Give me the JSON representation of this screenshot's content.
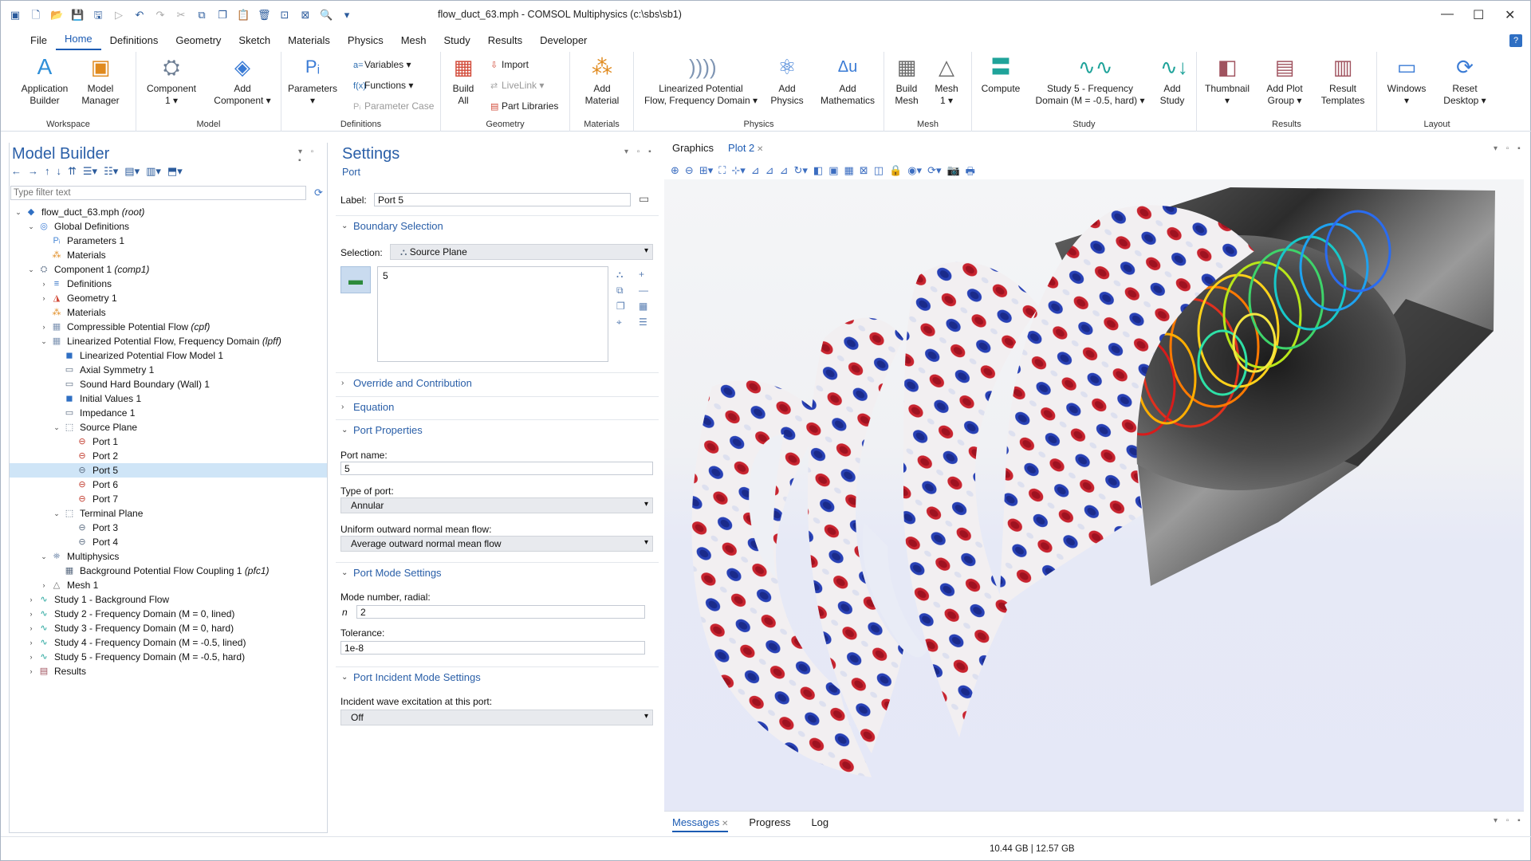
{
  "window": {
    "title": "flow_duct_63.mph - COMSOL Multiphysics (c:\\sbs\\sb1)",
    "minimize_glyph": "—",
    "maximize_glyph": "☐",
    "close_glyph": "✕"
  },
  "menu": {
    "tabs": [
      "File",
      "Home",
      "Definitions",
      "Geometry",
      "Sketch",
      "Materials",
      "Physics",
      "Mesh",
      "Study",
      "Results",
      "Developer"
    ],
    "active": "Home",
    "help": "?"
  },
  "ribbon": {
    "groups": {
      "workspace": "Workspace",
      "model": "Model",
      "definitions": "Definitions",
      "geometry": "Geometry",
      "materials": "Materials",
      "physics": "Physics",
      "mesh": "Mesh",
      "study": "Study",
      "results": "Results",
      "layout": "Layout"
    },
    "buttons": {
      "app_builder": [
        "Application",
        "Builder"
      ],
      "model_manager": [
        "Model",
        "Manager"
      ],
      "component": [
        "Component",
        "1 ▾"
      ],
      "add_component": [
        "Add",
        "Component ▾"
      ],
      "parameters": [
        "Parameters",
        "▾"
      ],
      "variables": "Variables ▾",
      "functions": "Functions ▾",
      "parameter_case": "Parameter Case",
      "build_all": [
        "Build",
        "All"
      ],
      "import": "Import",
      "livelink": "LiveLink ▾",
      "part_libraries": "Part Libraries",
      "add_material": [
        "Add",
        "Material"
      ],
      "lpff": [
        "Linearized Potential",
        "Flow, Frequency Domain ▾"
      ],
      "add_physics": [
        "Add",
        "Physics"
      ],
      "add_mathematics": [
        "Add",
        "Mathematics"
      ],
      "build_mesh": [
        "Build",
        "Mesh"
      ],
      "mesh1": [
        "Mesh",
        "1 ▾"
      ],
      "compute": [
        "Compute",
        ""
      ],
      "study5": [
        "Study 5 - Frequency",
        "Domain (M = -0.5, hard) ▾"
      ],
      "add_study": [
        "Add",
        "Study"
      ],
      "thumbnail": [
        "Thumbnail",
        "▾"
      ],
      "add_plot_group": [
        "Add Plot",
        "Group ▾"
      ],
      "result_templates": [
        "Result",
        "Templates"
      ],
      "windows": [
        "Windows",
        "▾"
      ],
      "reset_desktop": [
        "Reset",
        "Desktop ▾"
      ]
    }
  },
  "model_builder": {
    "title": "Model Builder",
    "filter_placeholder": "Type filter text",
    "tree": [
      {
        "label": "flow_duct_63.mph",
        "italic": "(root)",
        "level": 0,
        "exp": "v",
        "icon": "model-icon",
        "color": "#2f6fc3"
      },
      {
        "label": "Global Definitions",
        "italic": "",
        "level": 1,
        "exp": "v",
        "icon": "globe-icon",
        "color": "#3a7bd5"
      },
      {
        "label": "Parameters 1",
        "italic": "",
        "level": 2,
        "exp": "",
        "icon": "parameters-icon",
        "color": "#4a88d6"
      },
      {
        "label": "Materials",
        "italic": "",
        "level": 2,
        "exp": "",
        "icon": "materials-icon",
        "color": "#e08a1e"
      },
      {
        "label": "Component 1",
        "italic": "(comp1)",
        "level": 1,
        "exp": "v",
        "icon": "component-icon",
        "color": "#6d7e94"
      },
      {
        "label": "Definitions",
        "italic": "",
        "level": 2,
        "exp": ">",
        "icon": "definitions-icon",
        "color": "#2f6fc3"
      },
      {
        "label": "Geometry 1",
        "italic": "",
        "level": 2,
        "exp": ">",
        "icon": "geometry-icon",
        "color": "#d24b3a"
      },
      {
        "label": "Materials",
        "italic": "",
        "level": 2,
        "exp": "",
        "icon": "materials-icon",
        "color": "#e08a1e"
      },
      {
        "label": "Compressible Potential Flow",
        "italic": "(cpf)",
        "level": 2,
        "exp": ">",
        "icon": "flow-icon",
        "color": "#7f95b3"
      },
      {
        "label": "Linearized Potential Flow, Frequency Domain",
        "italic": "(lpff)",
        "level": 2,
        "exp": "v",
        "icon": "acoustics-icon",
        "color": "#7f95b3"
      },
      {
        "label": "Linearized Potential Flow Model 1",
        "italic": "",
        "level": 3,
        "exp": "",
        "icon": "domain-feature-icon",
        "color": "#2f6fc3"
      },
      {
        "label": "Axial Symmetry 1",
        "italic": "",
        "level": 3,
        "exp": "",
        "icon": "boundary-feature-icon",
        "color": "#5a6b80"
      },
      {
        "label": "Sound Hard Boundary (Wall) 1",
        "italic": "",
        "level": 3,
        "exp": "",
        "icon": "boundary-feature-icon",
        "color": "#5a6b80"
      },
      {
        "label": "Initial Values 1",
        "italic": "",
        "level": 3,
        "exp": "",
        "icon": "domain-feature-icon",
        "color": "#2f6fc3"
      },
      {
        "label": "Impedance 1",
        "italic": "",
        "level": 3,
        "exp": "",
        "icon": "boundary-feature-icon",
        "color": "#5a6b80"
      },
      {
        "label": "Source Plane",
        "italic": "",
        "level": 3,
        "exp": "v",
        "icon": "port-group-icon",
        "color": "#5a6b80"
      },
      {
        "label": "Port 1",
        "italic": "",
        "level": 4,
        "exp": "",
        "icon": "port-icon",
        "color": "#c0392b"
      },
      {
        "label": "Port 2",
        "italic": "",
        "level": 4,
        "exp": "",
        "icon": "port-icon",
        "color": "#c0392b"
      },
      {
        "label": "Port 5",
        "italic": "",
        "level": 4,
        "exp": "",
        "icon": "port-icon",
        "color": "#5a6b80",
        "selected": true
      },
      {
        "label": "Port 6",
        "italic": "",
        "level": 4,
        "exp": "",
        "icon": "port-icon",
        "color": "#c0392b"
      },
      {
        "label": "Port 7",
        "italic": "",
        "level": 4,
        "exp": "",
        "icon": "port-icon",
        "color": "#c0392b"
      },
      {
        "label": "Terminal Plane",
        "italic": "",
        "level": 3,
        "exp": "v",
        "icon": "port-group-icon",
        "color": "#5a6b80"
      },
      {
        "label": "Port 3",
        "italic": "",
        "level": 4,
        "exp": "",
        "icon": "port-icon",
        "color": "#5a6b80"
      },
      {
        "label": "Port 4",
        "italic": "",
        "level": 4,
        "exp": "",
        "icon": "port-icon",
        "color": "#5a6b80"
      },
      {
        "label": "Multiphysics",
        "italic": "",
        "level": 2,
        "exp": "v",
        "icon": "multiphysics-icon",
        "color": "#7f95b3"
      },
      {
        "label": "Background Potential Flow Coupling 1",
        "italic": "(pfc1)",
        "level": 3,
        "exp": "",
        "icon": "coupling-icon",
        "color": "#5a6b80"
      },
      {
        "label": "Mesh 1",
        "italic": "",
        "level": 2,
        "exp": ">",
        "icon": "mesh-icon",
        "color": "#6b6b6b"
      },
      {
        "label": "Study 1 - Background Flow",
        "italic": "",
        "level": 1,
        "exp": ">",
        "icon": "study-icon",
        "color": "#1fa39a"
      },
      {
        "label": "Study 2 - Frequency Domain (M = 0, lined)",
        "italic": "",
        "level": 1,
        "exp": ">",
        "icon": "study-icon",
        "color": "#1fa39a"
      },
      {
        "label": "Study 3 - Frequency Domain (M = 0, hard)",
        "italic": "",
        "level": 1,
        "exp": ">",
        "icon": "study-icon",
        "color": "#1fa39a"
      },
      {
        "label": "Study 4 - Frequency Domain (M = -0.5, lined)",
        "italic": "",
        "level": 1,
        "exp": ">",
        "icon": "study-icon",
        "color": "#1fa39a"
      },
      {
        "label": "Study 5 - Frequency Domain (M = -0.5, hard)",
        "italic": "",
        "level": 1,
        "exp": ">",
        "icon": "study-icon",
        "color": "#1fa39a"
      },
      {
        "label": "Results",
        "italic": "",
        "level": 1,
        "exp": ">",
        "icon": "results-icon",
        "color": "#a0535f"
      }
    ]
  },
  "settings": {
    "title": "Settings",
    "subtitle": "Port",
    "label_caption": "Label:",
    "label_value": "Port 5",
    "boundary_selection": "Boundary Selection",
    "selection_caption": "Selection:",
    "selection_value": "Source Plane",
    "selection_list": "5",
    "override": "Override and Contribution",
    "equation": "Equation",
    "port_properties": "Port Properties",
    "port_name_caption": "Port name:",
    "port_name_value": "5",
    "type_caption": "Type of port:",
    "type_value": "Annular",
    "uniform_caption": "Uniform outward normal mean flow:",
    "uniform_value": "Average outward normal mean flow",
    "port_mode": "Port Mode Settings",
    "mode_number_caption": "Mode number, radial:",
    "mode_var": "n",
    "mode_number_value": "2",
    "tolerance_caption": "Tolerance:",
    "tolerance_value": "1e-8",
    "incident_mode": "Port Incident Mode Settings",
    "incident_caption": "Incident wave excitation at this port:",
    "incident_value": "Off"
  },
  "graphics": {
    "tabs": [
      "Graphics",
      "Plot 2"
    ],
    "active": "Plot 2"
  },
  "messages": {
    "tabs": [
      "Messages",
      "Progress",
      "Log"
    ],
    "active": "Messages"
  },
  "status": {
    "memory": "10.44 GB | 12.57 GB"
  }
}
